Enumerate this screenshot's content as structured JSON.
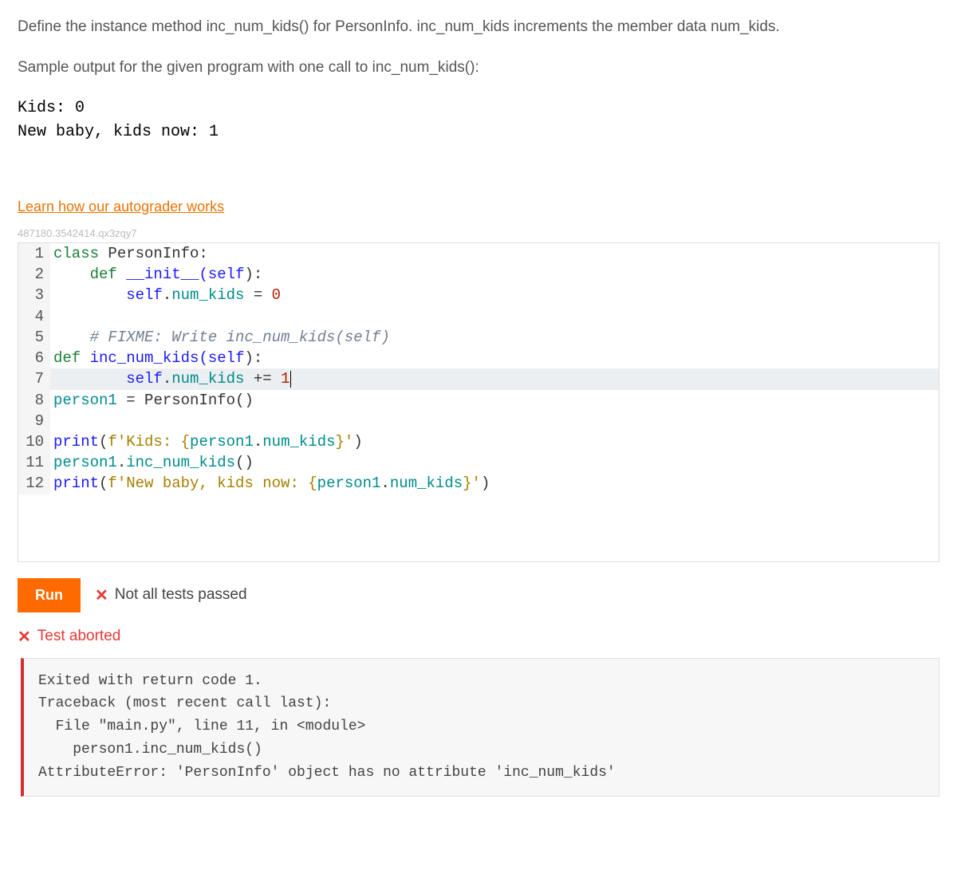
{
  "instructions": {
    "p1": "Define the instance method inc_num_kids() for PersonInfo. inc_num_kids increments the member data num_kids.",
    "p2": "Sample output for the given program with one call to inc_num_kids():"
  },
  "sample_output": "Kids: 0\nNew baby, kids now: 1",
  "link_text": "Learn how our autograder works",
  "watermark": "487180.3542414.qx3zqy7",
  "code": {
    "l1": {
      "kw1": "class",
      "name": " PersonInfo:"
    },
    "l2": {
      "kw1": "def",
      "name1": " __init__(",
      "self": "self",
      "name2": "):"
    },
    "l3": {
      "self": "self",
      "dot": ".",
      "fld": "num_kids",
      "eq": " = ",
      "num": "0"
    },
    "l4": "",
    "l5_comment": "# FIXME: Write inc_num_kids(self)",
    "l6": {
      "kw1": "def",
      "name1": " inc_num_kids(",
      "self": "self",
      "name2": "):"
    },
    "l7": {
      "self": "self",
      "dot": ".",
      "fld": "num_kids",
      "op": " += ",
      "num": "1"
    },
    "l8": {
      "var": "person1",
      "eq": " = ",
      "call": "PersonInfo()"
    },
    "l9": "",
    "l10": {
      "fn": "print",
      "p1": "(",
      "f": "f",
      "s1": "'Kids: {",
      "v": "person1",
      "dot": ".",
      "fld": "num_kids",
      "s2": "}'",
      "p2": ")"
    },
    "l11": {
      "v": "person1",
      "dot": ".",
      "m": "inc_num_kids",
      "p": "()"
    },
    "l12": {
      "fn": "print",
      "p1": "(",
      "f": "f",
      "s1": "'New baby, kids now: {",
      "v": "person1",
      "dot": ".",
      "fld": "num_kids",
      "s2": "}'",
      "p2": ")"
    }
  },
  "run_label": "Run",
  "status_text": "Not all tests passed",
  "aborted_text": "Test aborted",
  "error_output": "Exited with return code 1.\nTraceback (most recent call last):\n  File \"main.py\", line 11, in <module>\n    person1.inc_num_kids()\nAttributeError: 'PersonInfo' object has no attribute 'inc_num_kids'"
}
